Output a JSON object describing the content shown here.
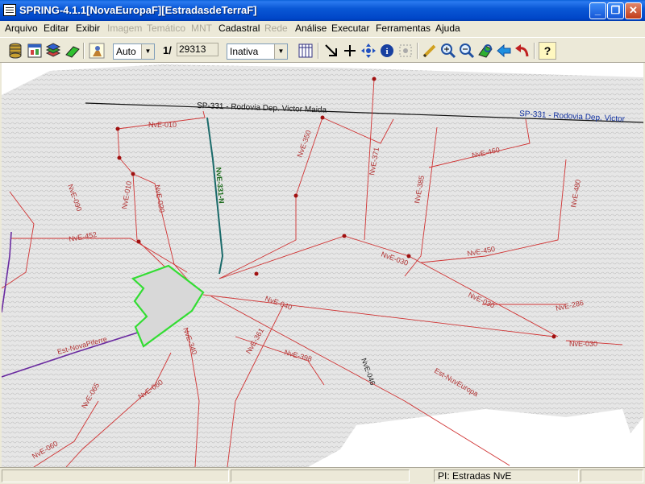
{
  "window": {
    "title": "SPRING-4.1.1[NovaEuropaF][EstradasdeTerraF]",
    "minimize": "_",
    "maximize": "❐",
    "close": "✕"
  },
  "menu": [
    {
      "label": "Arquivo",
      "enabled": true
    },
    {
      "label": "Editar",
      "enabled": true
    },
    {
      "label": "Exibir",
      "enabled": true
    },
    {
      "label": "Imagem",
      "enabled": false
    },
    {
      "label": "Temático",
      "enabled": false
    },
    {
      "label": "MNT",
      "enabled": false
    },
    {
      "label": "Cadastral",
      "enabled": true
    },
    {
      "label": "Rede",
      "enabled": false
    },
    {
      "label": "Análise",
      "enabled": true
    },
    {
      "label": "Executar",
      "enabled": true
    },
    {
      "label": "Ferramentas",
      "enabled": true
    },
    {
      "label": "Ajuda",
      "enabled": true
    }
  ],
  "toolbar": {
    "zoom_mode": "Auto",
    "scale_prefix": "1/",
    "scale_value": "29313",
    "layer_mode": "Inativa",
    "help_glyph": "?"
  },
  "map": {
    "highway_label_1": "SP-331 - Rodovia Dep. Victor Maida",
    "highway_label_2": "SP-331 - Rodovia Dep. Victor",
    "road_labels": {
      "nve010_top": "NvE-010",
      "nve350": "NvE-350",
      "nve371": "NvE-371",
      "nve460": "NvE-460",
      "nve385": "NvE-385",
      "nve480": "NvE-480",
      "nve090": "NvE-090",
      "nve010_left": "NvE-010",
      "nve020": "NvE-020",
      "nve452": "NvE-452",
      "nve450": "NvE-450",
      "nve030_a": "NvE-030",
      "nve030_b": "NvE-030",
      "nve030_c": "NvE-030",
      "nve040": "NvE-040",
      "nve286": "NvE-286",
      "nve361": "NvE-361",
      "nve398": "NvE-398",
      "nve340": "NvE-340",
      "nve046": "NvE-046",
      "nve065": "NvE-065",
      "nve060_a": "NvE-060",
      "nve060_b": "NvE-060",
      "est_nueva": "Est-NuvEuropa",
      "est_piferre": "Est-NovaPiferre",
      "green_road": "NvE-331-N"
    },
    "colors": {
      "road": "#d03434",
      "highway": "#000000",
      "urban": "#33dd33",
      "teal_road": "#1a6a6a",
      "purple_road": "#6a2aa0"
    }
  },
  "status": {
    "pane1": "",
    "pane2": "",
    "pane3": "PI: Estradas NvE",
    "pane4": ""
  }
}
